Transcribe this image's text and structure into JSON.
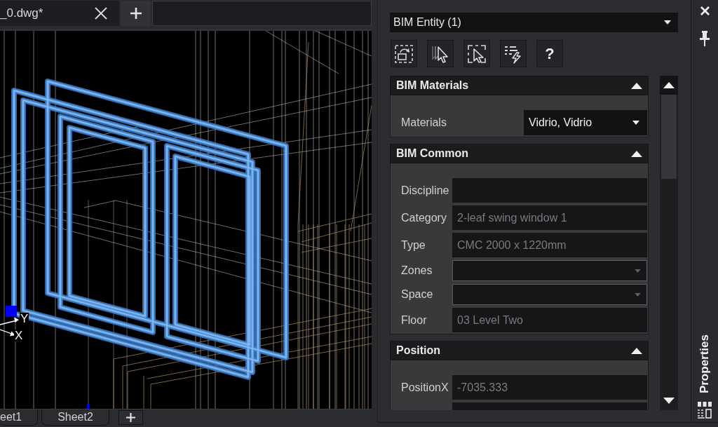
{
  "document_tabs": [
    {
      "label": "_0.dwg*",
      "selected": true
    }
  ],
  "viewport": {
    "ucs_icon": {
      "y_label": "Y",
      "x_label": "X"
    }
  },
  "sheet_tabs": [
    {
      "label": "eet1",
      "selected": false
    },
    {
      "label": "Sheet2",
      "selected": false
    }
  ],
  "properties": {
    "entity_select": "BIM Entity (1)",
    "help_label": "?",
    "sections": [
      {
        "title": "BIM Materials",
        "expanded": true,
        "rows": [
          {
            "label": "Materials",
            "kind": "dropdown",
            "value": "Vidrio, Vidrio",
            "disabled": false
          }
        ]
      },
      {
        "title": "BIM Common",
        "expanded": true,
        "rows": [
          {
            "label": "Discipline",
            "kind": "field",
            "disabled": true
          },
          {
            "label": "Category",
            "kind": "field",
            "value": "2-leaf swing window 1",
            "disabled": true
          },
          {
            "label": "Type",
            "kind": "field",
            "value": "CMC 2000 x 1220mm",
            "disabled": true
          },
          {
            "label": "Zones",
            "kind": "combo",
            "disabled": false
          },
          {
            "label": "Space",
            "kind": "combo",
            "disabled": false
          },
          {
            "label": "Floor",
            "kind": "field",
            "value": "03 Level Two",
            "disabled": true
          }
        ]
      },
      {
        "title": "Position",
        "expanded": true,
        "rows": [
          {
            "label": "PositionX",
            "kind": "field",
            "value": "-7035.333",
            "disabled": true
          },
          {
            "kind": "field",
            "disabled": true
          }
        ]
      }
    ]
  },
  "side_strip": {
    "title": "Properties"
  }
}
